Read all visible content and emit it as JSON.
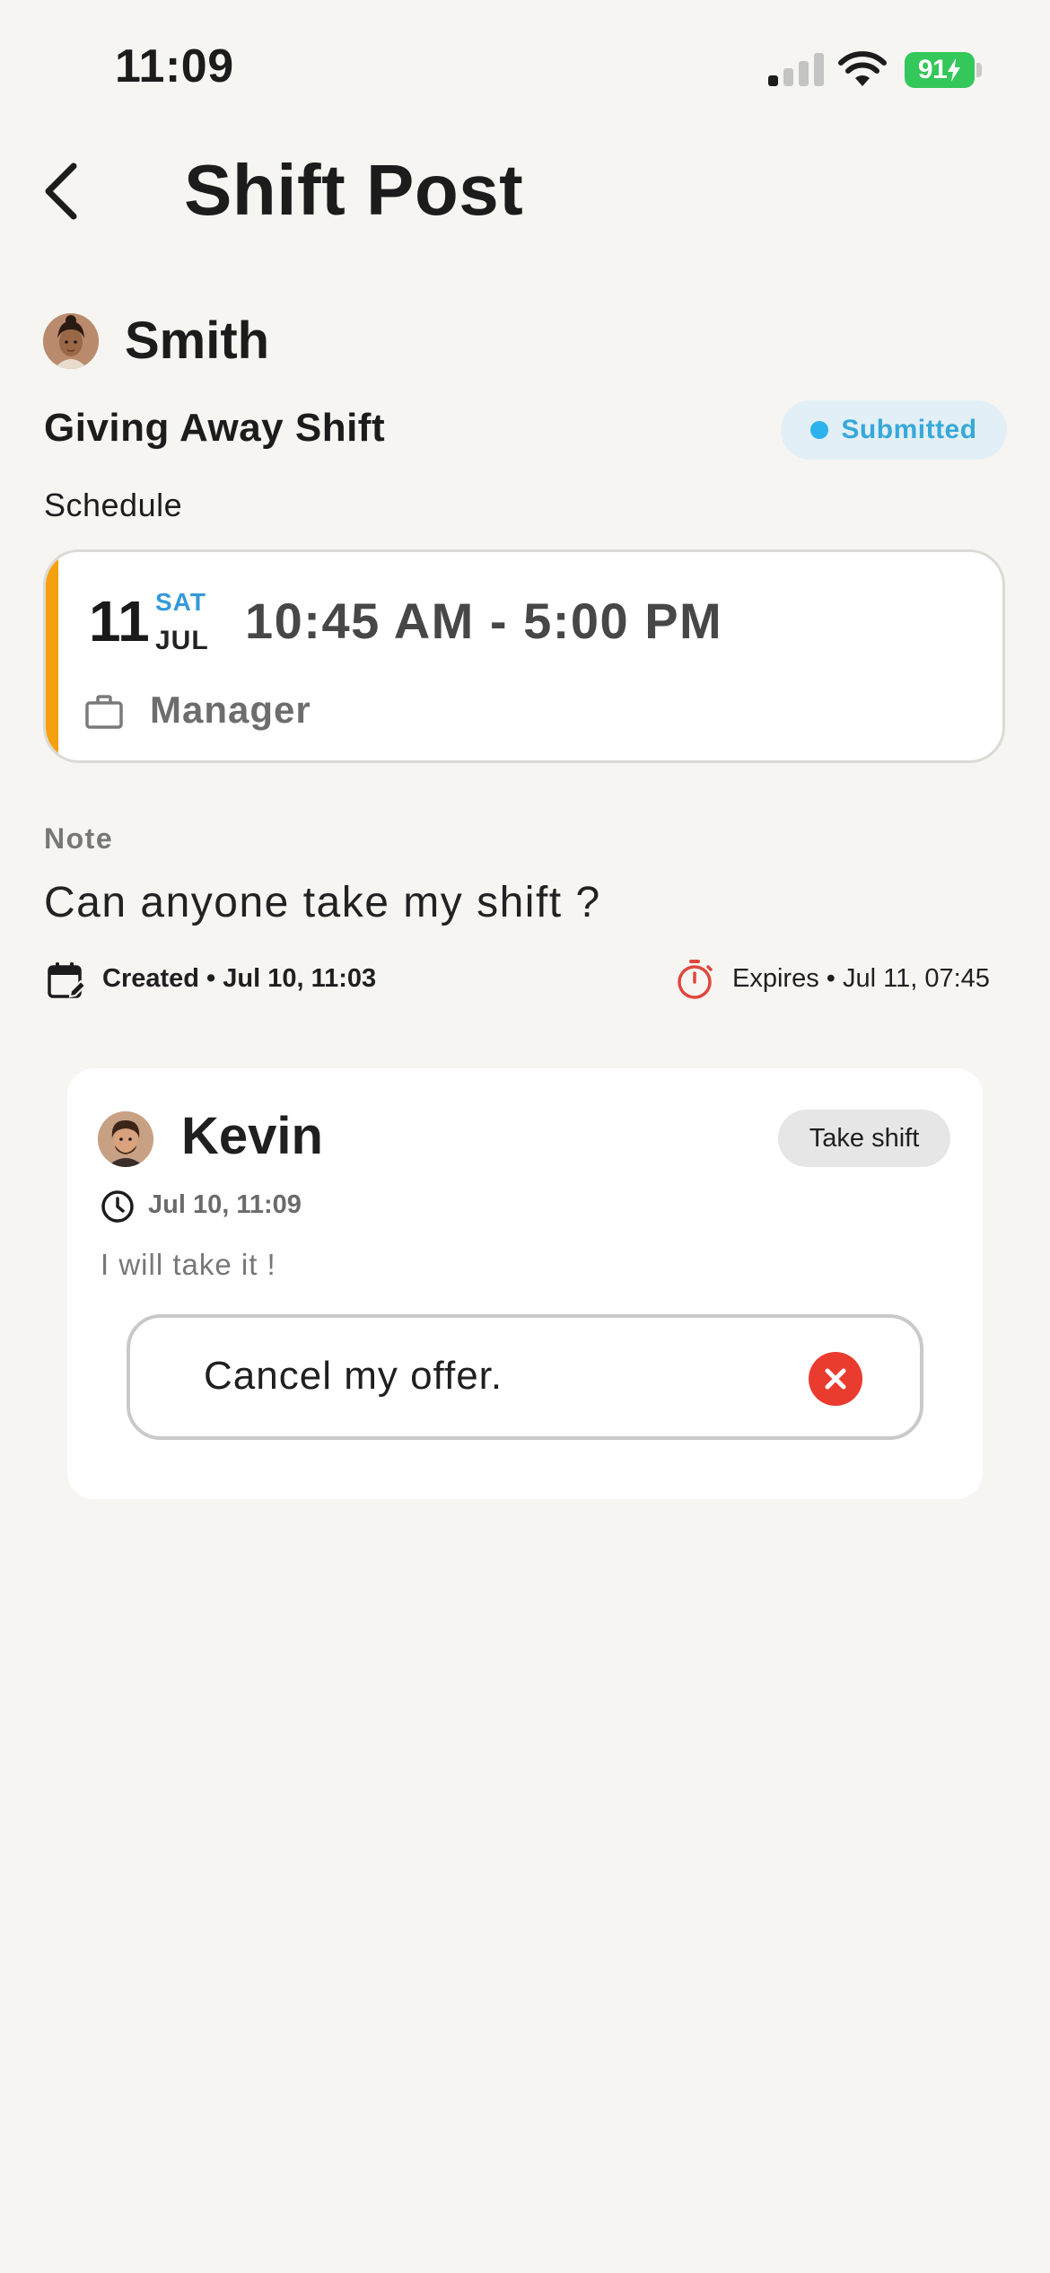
{
  "status_bar": {
    "time": "11:09",
    "battery": "91"
  },
  "header": {
    "title": "Shift Post",
    "back_icon": "chevron-left-icon"
  },
  "post": {
    "poster_name": "Smith",
    "type": "Giving Away Shift",
    "status": "Submitted",
    "status_color": "#2cb2ee",
    "schedule_label": "Schedule",
    "schedule": {
      "day": "11",
      "weekday": "SAT",
      "month": "JUL",
      "time_range": "10:45 AM - 5:00 PM",
      "role": "Manager",
      "accent_color": "#f5a00e"
    },
    "note_label": "Note",
    "note_text": "Can anyone take my shift ?",
    "created": "Created • Jul 10, 11:03",
    "expires": "Expires • Jul 11, 07:45"
  },
  "offer": {
    "name": "Kevin",
    "take_shift_label": "Take shift",
    "time": "Jul 10, 11:09",
    "message": "I will take it !",
    "cancel_label": "Cancel my offer.",
    "cancel_color": "#ea3b2f"
  }
}
